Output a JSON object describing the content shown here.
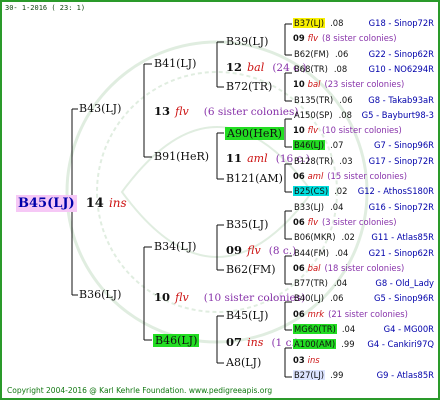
{
  "header": "30-  1-2016 ( 23:  1)",
  "footer": "Copyright 2004-2016 @ Karl Kehrle Foundation.   www.pedigreeapis.org",
  "root": {
    "name": "B45(LJ)",
    "num": "14",
    "color": "ins"
  },
  "gen1": [
    {
      "name": "B43(LJ)",
      "num": "13",
      "color": "flv",
      "sis": "(6 sister colonies)"
    },
    {
      "name": "B36(LJ)",
      "num": "10",
      "color": "flv",
      "sis": "(10 sister colonies)"
    }
  ],
  "gen2": [
    {
      "name": "B41(LJ)"
    },
    {
      "name": "B91(HeR)"
    },
    {
      "name": "B34(LJ)"
    },
    {
      "name": "B46(LJ)"
    }
  ],
  "gen3": [
    {
      "name": "B39(LJ)"
    },
    {
      "num": "12",
      "color": "bal",
      "sis": "(24 c.)"
    },
    {
      "name": "B72(TR)"
    },
    {
      "name": "A90(HeR)"
    },
    {
      "num": "11",
      "color": "aml",
      "sis": "(16 c.)"
    },
    {
      "name": "B121(AM)"
    },
    {
      "name": "B35(LJ)"
    },
    {
      "num": "09",
      "color": "flv",
      "sis": "(8 c.)"
    },
    {
      "name": "B62(FM)"
    },
    {
      "name": "B45(LJ)"
    },
    {
      "num": "07",
      "color": "ins",
      "sis": "(1 c.)"
    },
    {
      "name": "A8(LJ)"
    }
  ],
  "gen4": [
    {
      "type": "p",
      "name": "B37(LJ)",
      "year": ".08",
      "origin": "G18 - Sinop72R"
    },
    {
      "type": "s",
      "num": "09",
      "color": "flv",
      "sis": "(8 sister colonies)"
    },
    {
      "type": "p",
      "name": "B62(FM)",
      "year": ".06",
      "origin": "G22 - Sinop62R"
    },
    {
      "type": "p",
      "name": "B68(TR)",
      "year": ".08",
      "origin": "G10 - NO6294R"
    },
    {
      "type": "s",
      "num": "10",
      "color": "bal",
      "sis": "(23 sister colonies)"
    },
    {
      "type": "p",
      "name": "B135(TR)",
      "year": ".06",
      "origin": "G8 - Takab93aR"
    },
    {
      "type": "p",
      "name": "A150(SP)",
      "year": ".08",
      "origin": "G5 - Bayburt98-3"
    },
    {
      "type": "s",
      "num": "10",
      "color": "flv",
      "sis": "(10 sister colonies)"
    },
    {
      "type": "p",
      "name": "B46(LJ)",
      "year": ".07",
      "origin": "G7 - Sinop96R"
    },
    {
      "type": "p",
      "name": "B128(TR)",
      "year": ".03",
      "origin": "G17 - Sinop72R"
    },
    {
      "type": "s",
      "num": "06",
      "color": "aml",
      "sis": "(15 sister colonies)"
    },
    {
      "type": "p",
      "name": "B25(CS)",
      "year": ".02",
      "origin": "G12 - AthosS180R"
    },
    {
      "type": "p",
      "name": "B33(LJ)",
      "year": ".04",
      "origin": "G16 - Sinop72R"
    },
    {
      "type": "s",
      "num": "06",
      "color": "flv",
      "sis": "(3 sister colonies)"
    },
    {
      "type": "p",
      "name": "B06(MKR)",
      "year": ".02",
      "origin": "G11 - Atlas85R"
    },
    {
      "type": "p",
      "name": "B44(FM)",
      "year": ".04",
      "origin": "G21 - Sinop62R"
    },
    {
      "type": "s",
      "num": "06",
      "color": "bal",
      "sis": "(18 sister colonies)"
    },
    {
      "type": "p",
      "name": "B77(TR)",
      "year": ".04",
      "origin": "G8 - Old_Lady"
    },
    {
      "type": "p",
      "name": "B40(LJ)",
      "year": ".06",
      "origin": "G5 - Sinop96R"
    },
    {
      "type": "s",
      "num": "06",
      "color": "mrk",
      "sis": "(21 sister colonies)"
    },
    {
      "type": "p",
      "name": "MG60(TR)",
      "year": ".04",
      "origin": "G4 - MG00R"
    },
    {
      "type": "p",
      "name": "A100(AM)",
      "year": ".99",
      "origin": "G4 - Cankiri97Q"
    },
    {
      "type": "s",
      "num": "03",
      "color": "ins",
      "sis": ""
    },
    {
      "type": "p",
      "name": "B27(LJ)",
      "year": ".99",
      "origin": "G9 - Atlas85R"
    }
  ]
}
